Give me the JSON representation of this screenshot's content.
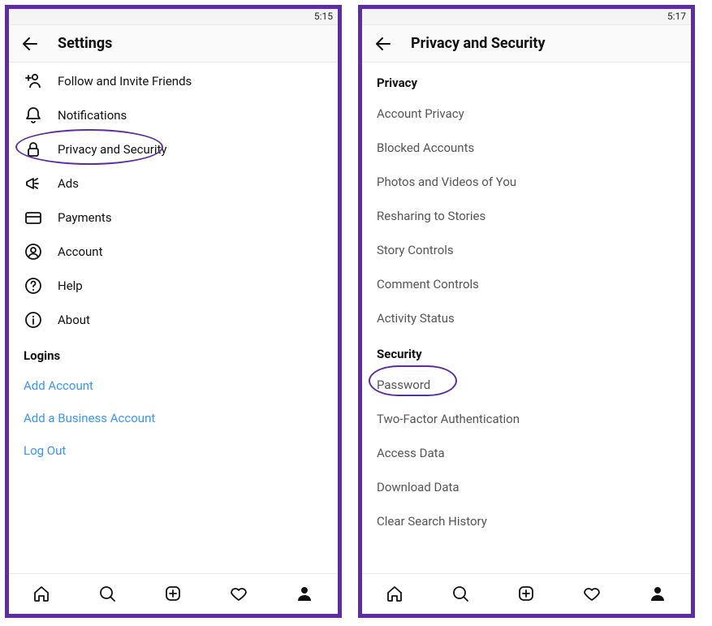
{
  "left": {
    "time": "5:15",
    "title": "Settings",
    "items": [
      {
        "icon": "follow",
        "label": "Follow and Invite Friends"
      },
      {
        "icon": "bell",
        "label": "Notifications"
      },
      {
        "icon": "lock",
        "label": "Privacy and Security",
        "circled": true
      },
      {
        "icon": "ads",
        "label": "Ads"
      },
      {
        "icon": "card",
        "label": "Payments"
      },
      {
        "icon": "user",
        "label": "Account"
      },
      {
        "icon": "help",
        "label": "Help"
      },
      {
        "icon": "info",
        "label": "About"
      }
    ],
    "logins_header": "Logins",
    "links": [
      {
        "label": "Add Account"
      },
      {
        "label": "Add a Business Account"
      },
      {
        "label": "Log Out"
      }
    ]
  },
  "right": {
    "time": "5:17",
    "title": "Privacy and Security",
    "section1": "Privacy",
    "list1": [
      "Account Privacy",
      "Blocked Accounts",
      "Photos and Videos of You",
      "Resharing to Stories",
      "Story Controls",
      "Comment Controls",
      "Activity Status"
    ],
    "section2": "Security",
    "list2": [
      {
        "label": "Password",
        "circled": true
      },
      {
        "label": "Two-Factor Authentication"
      },
      {
        "label": "Access Data"
      },
      {
        "label": "Download Data"
      },
      {
        "label": "Clear Search History"
      }
    ]
  },
  "tabs": [
    "home",
    "search",
    "add",
    "activity",
    "profile"
  ]
}
